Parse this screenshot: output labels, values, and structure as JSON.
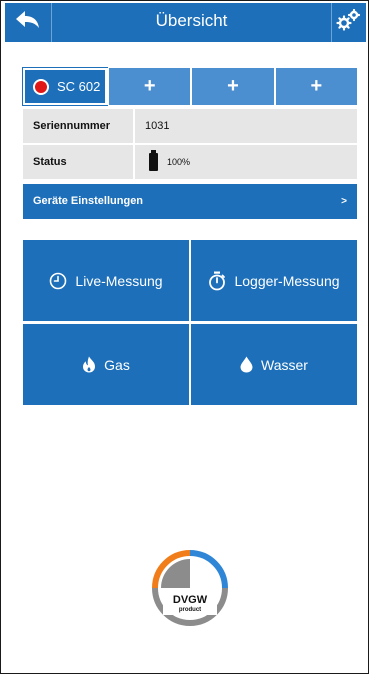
{
  "header": {
    "title": "Übersicht",
    "back_icon": "back-arrow-icon",
    "settings_icon": "gears-icon"
  },
  "tabs": [
    {
      "label": "SC 602",
      "status_color": "#e01717",
      "active": true
    },
    {
      "label": "+"
    },
    {
      "label": "+"
    },
    {
      "label": "+"
    }
  ],
  "info": {
    "serial_label": "Seriennummer",
    "serial_value": "1031",
    "status_label": "Status",
    "battery_percent": "100%",
    "battery_icon": "battery-full-icon"
  },
  "settings": {
    "label": "Geräte Einstellungen",
    "chevron": ">"
  },
  "tiles": {
    "live": {
      "label": "Live-Messung",
      "icon": "clock-icon"
    },
    "logger": {
      "label": "Logger-Messung",
      "icon": "stopwatch-icon"
    },
    "gas": {
      "label": "Gas",
      "icon": "flame-icon"
    },
    "water": {
      "label": "Wasser",
      "icon": "water-drop-icon"
    }
  },
  "logo": {
    "line1": "DVGW",
    "line2": "product"
  },
  "colors": {
    "primary": "#1d6fb9",
    "tab_inactive": "#4b8fd0",
    "row_bg": "#e6e6e6",
    "status_dot": "#e01717",
    "logo_orange": "#f07d1a",
    "logo_blue": "#2f86d6",
    "logo_gray": "#8c8c8c"
  }
}
